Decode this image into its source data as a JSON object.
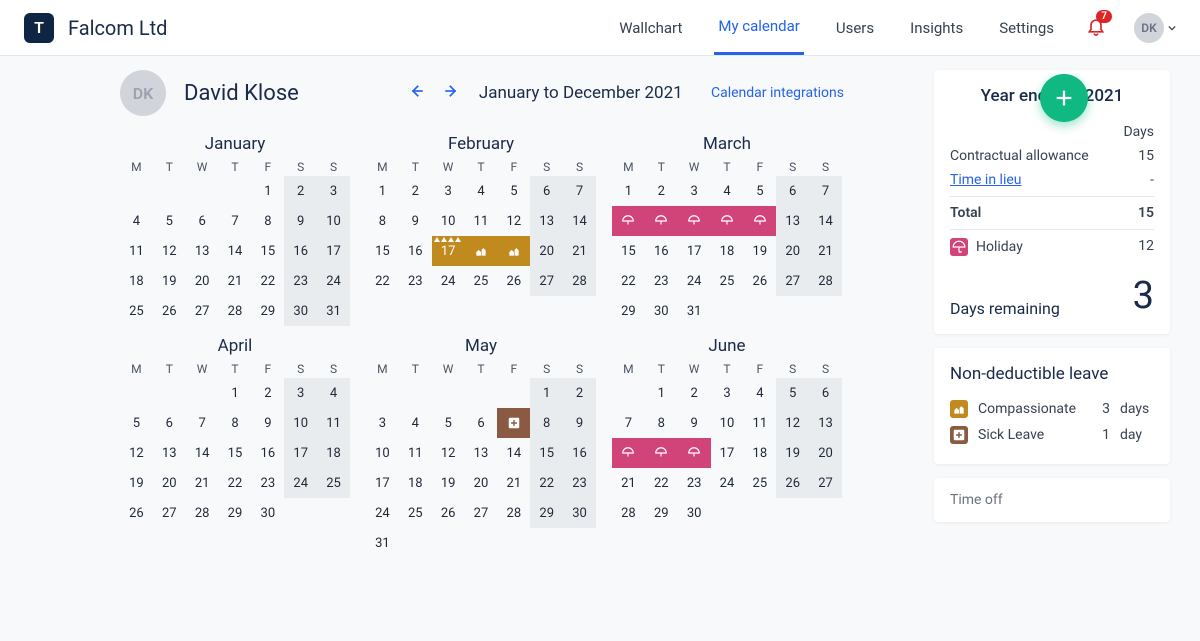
{
  "app": {
    "logo_letter": "T",
    "company": "Falcom Ltd",
    "nav": [
      "Wallchart",
      "My calendar",
      "Users",
      "Insights",
      "Settings"
    ],
    "nav_active_index": 1,
    "notif_count": "7",
    "user_initials": "DK"
  },
  "page": {
    "user_initials": "DK",
    "user_name": "David Klose",
    "range_label": "January to December 2021",
    "calendar_integrations": "Calendar integrations"
  },
  "weekdays": [
    "M",
    "T",
    "W",
    "T",
    "F",
    "S",
    "S"
  ],
  "months": [
    {
      "name": "January",
      "lead": 4,
      "count": 31,
      "marks": {}
    },
    {
      "name": "February",
      "lead": 0,
      "count": 28,
      "marks": {
        "17": "comp_tri",
        "18": "comp",
        "19": "comp"
      }
    },
    {
      "name": "March",
      "lead": 0,
      "count": 31,
      "marks": {
        "8": "holiday",
        "9": "holiday",
        "10": "holiday",
        "11": "holiday",
        "12": "holiday"
      }
    },
    {
      "name": "April",
      "lead": 3,
      "count": 30,
      "marks": {}
    },
    {
      "name": "May",
      "lead": 5,
      "count": 31,
      "marks": {
        "7": "sick"
      }
    },
    {
      "name": "June",
      "lead": 1,
      "count": 30,
      "marks": {
        "14": "holiday",
        "15": "holiday",
        "16": "holiday"
      }
    }
  ],
  "summary": {
    "title": "Year end Dec 2021",
    "days_label": "Days",
    "contractual_label": "Contractual allowance",
    "contractual_value": "15",
    "til_label": "Time in lieu",
    "til_value": "-",
    "total_label": "Total",
    "total_value": "15",
    "holiday_label": "Holiday",
    "holiday_value": "12",
    "remaining_label": "Days remaining",
    "remaining_value": "3"
  },
  "nondeduct": {
    "title": "Non-deductible leave",
    "rows": [
      {
        "icon": "gold",
        "label": "Compassionate",
        "value": "3",
        "unit": "days"
      },
      {
        "icon": "brown",
        "label": "Sick Leave",
        "value": "1",
        "unit": "day"
      }
    ]
  },
  "timeoff_label": "Time off"
}
